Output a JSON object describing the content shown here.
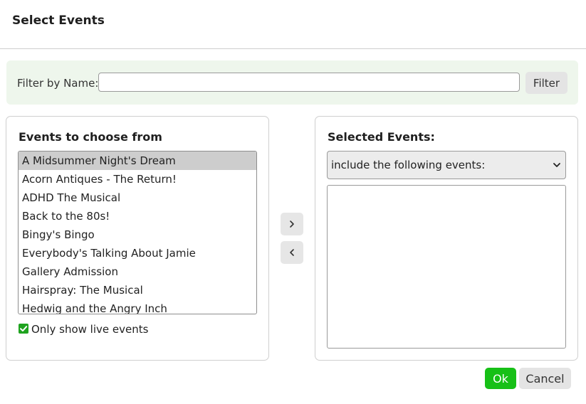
{
  "dialog": {
    "title": "Select Events"
  },
  "filter": {
    "label": "Filter by Name:",
    "value": "",
    "button_label": "Filter"
  },
  "left_panel": {
    "title": "Events to choose from",
    "items": [
      "A Midsummer Night's Dream",
      "Acorn Antiques - The Return!",
      "ADHD The Musical",
      "Back to the 80s!",
      "Bingy's Bingo",
      "Everybody's Talking About Jamie",
      "Gallery Admission",
      "Hairspray: The Musical",
      "Hedwig and the Angry Inch"
    ],
    "selected_index": 0,
    "checkbox_label": "Only show live events",
    "checkbox_checked": true
  },
  "right_panel": {
    "title": "Selected Events:",
    "mode_selected": "include the following events:",
    "items": []
  },
  "icons": {
    "move_right": "chevron-right-icon",
    "move_left": "chevron-left-icon",
    "dropdown": "chevron-down-icon",
    "check": "check-icon"
  },
  "actions": {
    "ok_label": "Ok",
    "cancel_label": "Cancel"
  },
  "colors": {
    "ok_button": "#17c017",
    "checkbox": "#1fa31f",
    "filter_bar": "#eef6ec",
    "selected_item": "#cdcdcd"
  }
}
